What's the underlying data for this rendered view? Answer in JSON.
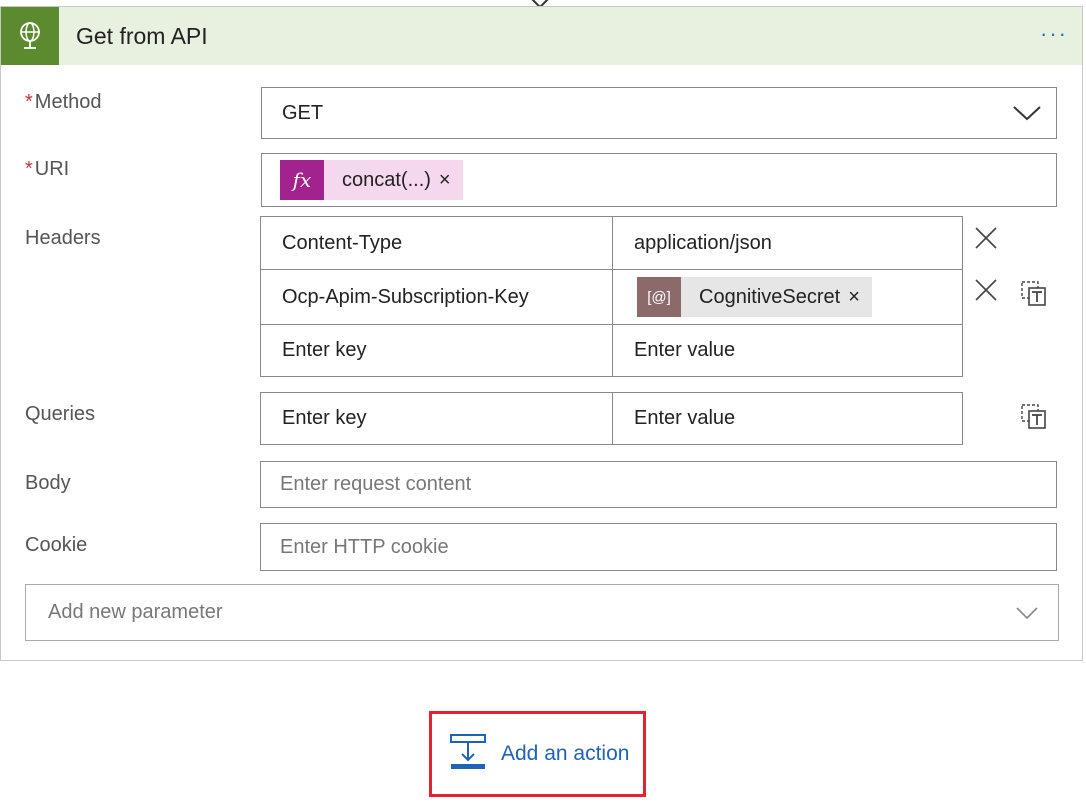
{
  "action": {
    "title": "Get from API",
    "more_label": "···",
    "icon": "globe-icon",
    "accent": "#5c8a2e"
  },
  "method": {
    "label": "Method",
    "required": "*",
    "value": "GET"
  },
  "uri": {
    "label": "URI",
    "required": "*",
    "token": {
      "icon_label": "fx",
      "label": "concat(...)",
      "remove": "×"
    }
  },
  "headers": {
    "label": "Headers",
    "rows": [
      {
        "key": "Content-Type",
        "value": "application/json"
      },
      {
        "key": "Ocp-Apim-Subscription-Key",
        "token_icon": "[@]",
        "token_label": "CognitiveSecret",
        "token_remove": "×"
      }
    ],
    "key_placeholder": "Enter key",
    "value_placeholder": "Enter value"
  },
  "queries": {
    "label": "Queries",
    "key_placeholder": "Enter key",
    "value_placeholder": "Enter value"
  },
  "body": {
    "label": "Body",
    "placeholder": "Enter request content"
  },
  "cookie": {
    "label": "Cookie",
    "placeholder": "Enter HTTP cookie"
  },
  "add_parameter": {
    "placeholder": "Add new parameter"
  },
  "add_action": {
    "label": "Add an action",
    "highlight": "#e32330"
  }
}
